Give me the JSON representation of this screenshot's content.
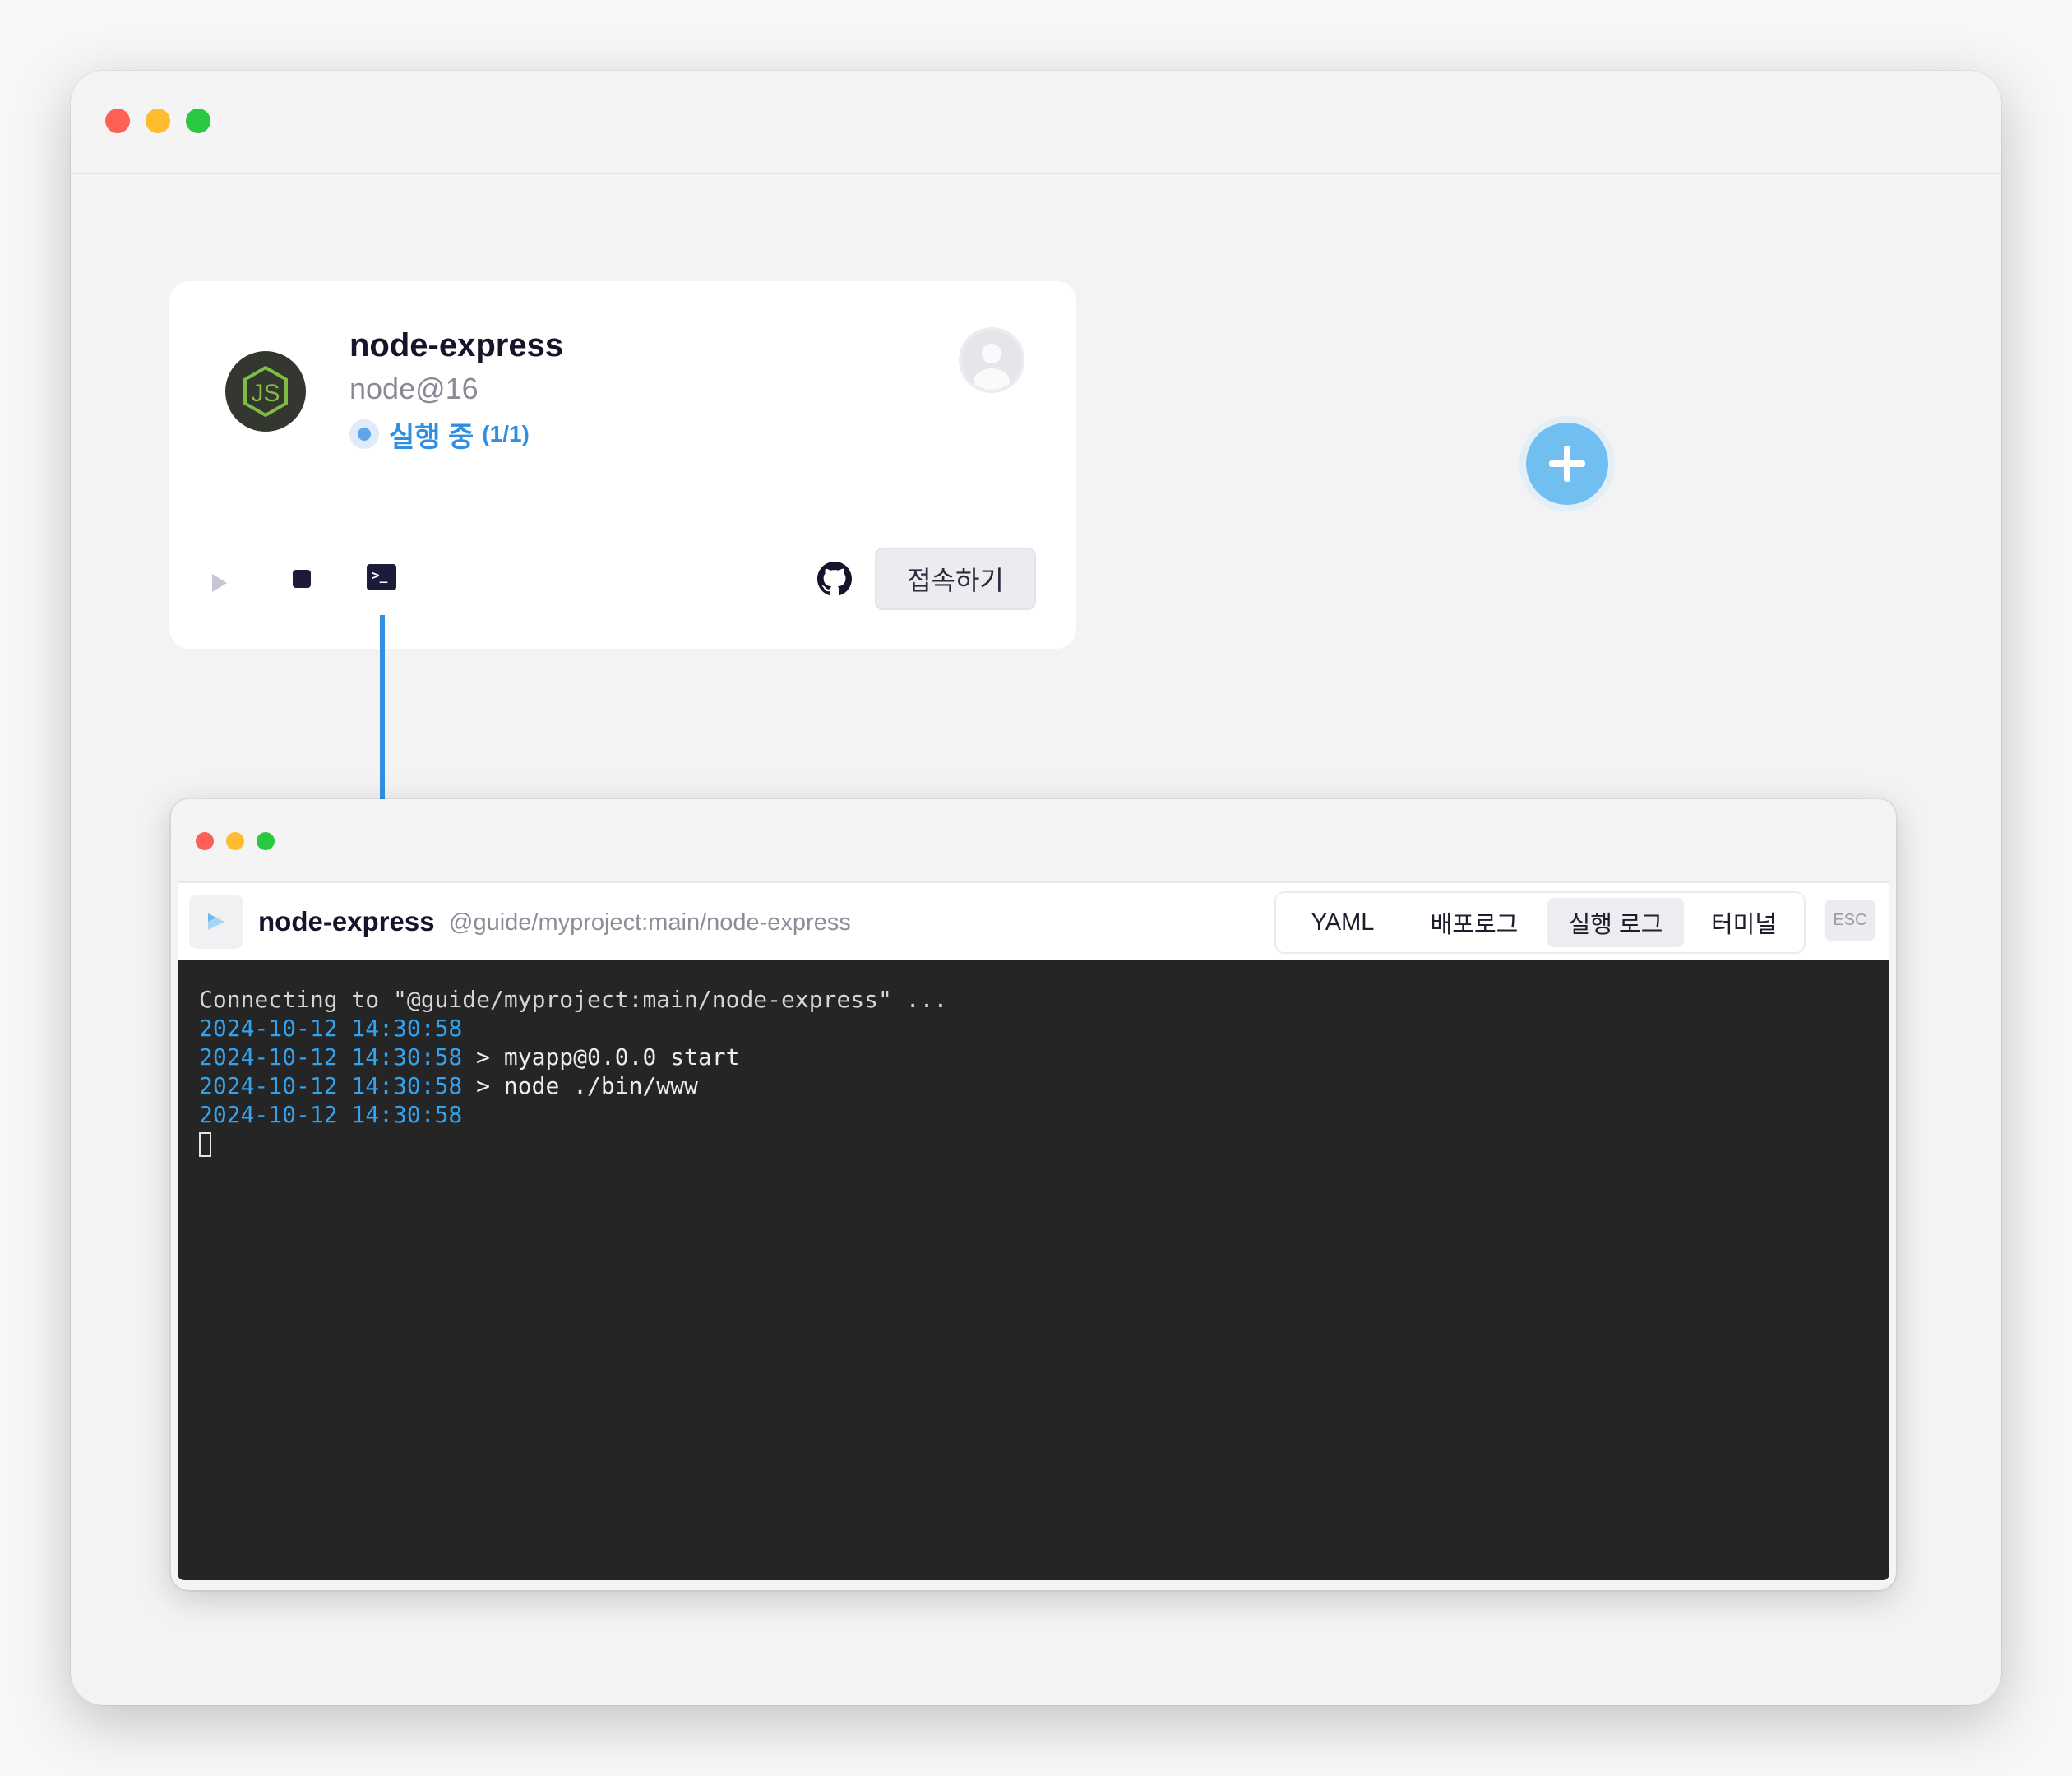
{
  "app_card": {
    "name": "node-express",
    "runtime": "node@16",
    "status_label": "실행 중",
    "status_count": "(1/1)",
    "connect_label": "접속하기"
  },
  "terminal_window": {
    "title": "node-express",
    "path": "@guide/myproject:main/node-express",
    "tabs": [
      {
        "label": "YAML",
        "active": false
      },
      {
        "label": "배포로그",
        "active": false
      },
      {
        "label": "실행 로그",
        "active": true
      },
      {
        "label": "터미널",
        "active": false
      }
    ],
    "esc_label": "ESC",
    "log_lines": [
      {
        "timestamp": "",
        "text": "Connecting to \"@guide/myproject:main/node-express\" ..."
      },
      {
        "timestamp": "2024-10-12 14:30:58",
        "text": ""
      },
      {
        "timestamp": "2024-10-12 14:30:58",
        "text": " > myapp@0.0.0 start"
      },
      {
        "timestamp": "2024-10-12 14:30:58",
        "text": " > node ./bin/www"
      },
      {
        "timestamp": "2024-10-12 14:30:58",
        "text": ""
      }
    ]
  },
  "colors": {
    "accent_blue": "#2f8fe3",
    "terminal_bg": "#252525",
    "timestamp": "#33a3ef"
  },
  "icons": [
    "nodejs-logo",
    "avatar-icon",
    "play-icon",
    "stop-icon",
    "terminal-icon",
    "github-icon",
    "plus-icon",
    "cube-icon"
  ]
}
